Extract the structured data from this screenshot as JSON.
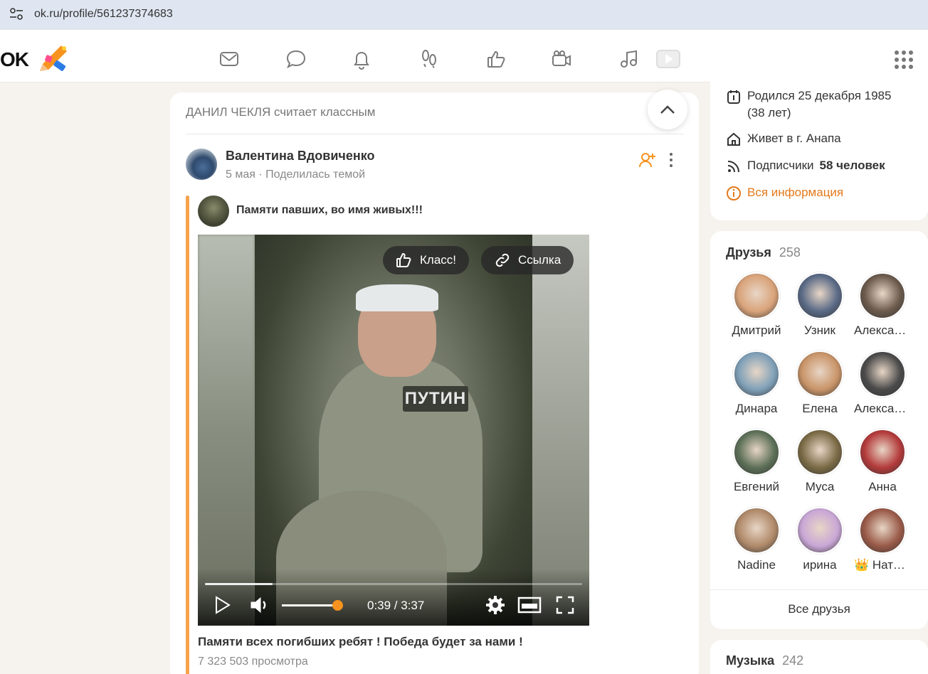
{
  "browser": {
    "url": "ok.ru/profile/561237374683"
  },
  "header": {
    "logo_text": "OK",
    "nav_icons": [
      "mail-icon",
      "chat-icon",
      "bell-icon",
      "footprints-icon",
      "like-icon",
      "video-camera-icon",
      "music-icon",
      "video-play-icon"
    ],
    "apps_icon": "apps-grid-icon"
  },
  "feed": {
    "liked_by_name": "ДАНИЛ ЧЕКЛЯ",
    "liked_by_action": "считает классным",
    "post": {
      "author": "Валентина Вдовиченко",
      "date": "5 мая",
      "meta_sep": "·",
      "meta_action": "Поделилась темой",
      "group_title": "Памяти павших, во имя живых!!!",
      "video": {
        "overlay_text": "ПУТИН",
        "like_button": "Класс!",
        "link_button": "Ссылка",
        "time": "0:39 / 3:37",
        "progress_fraction": 0.18,
        "volume_fraction": 0.93
      },
      "video_title": "Памяти всех погибших ребят ! Победа будет за нами !",
      "views": "7 323 503 просмотра"
    }
  },
  "profile_info": {
    "birthday": "Родился 25 декабря 1985",
    "age": "(38 лет)",
    "city": "Живет в г. Анапа",
    "subscribers_label": "Подписчики",
    "subscribers_count": "58 человек",
    "all_info": "Вся информация"
  },
  "friends": {
    "title": "Друзья",
    "count": "258",
    "items": [
      {
        "name": "Дмитрий",
        "color": "#d9a37a"
      },
      {
        "name": "Узник",
        "color": "#5a6a86"
      },
      {
        "name": "Александр",
        "color": "#6b5a4c"
      },
      {
        "name": "Динара",
        "color": "#7fa0b8"
      },
      {
        "name": "Елена",
        "color": "#c99468"
      },
      {
        "name": "Александр",
        "color": "#4a4a4a"
      },
      {
        "name": "Евгений",
        "color": "#5c6f57"
      },
      {
        "name": "Муса",
        "color": "#7a6a45"
      },
      {
        "name": "Анна",
        "color": "#b33a3a"
      },
      {
        "name": "Nadine",
        "color": "#b08a6a"
      },
      {
        "name": "ирина",
        "color": "#c9a7d6"
      },
      {
        "name": "👑 Наталья",
        "color": "#9a5a48"
      }
    ],
    "all_link": "Все друзья"
  },
  "music": {
    "title": "Музыка",
    "count": "242"
  },
  "colors": {
    "accent": "#f7931e",
    "link": "#e37a1c"
  }
}
